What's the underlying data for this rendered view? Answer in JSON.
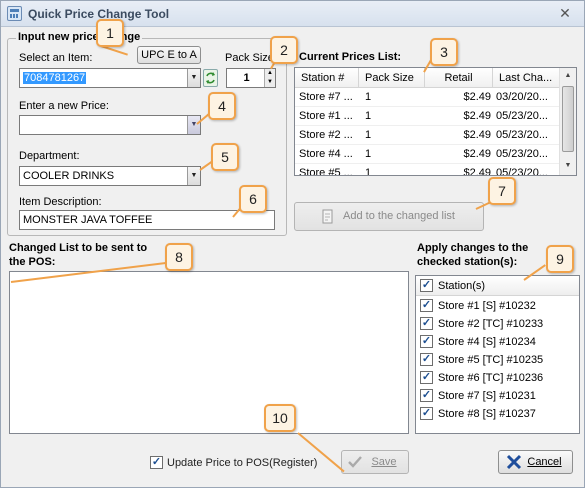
{
  "window": {
    "title": "Quick Price Change Tool",
    "close_glyph": "✕"
  },
  "input_group": {
    "legend": "Input new price change",
    "select_item_label": "Select an Item:",
    "upc_button": "UPC E to A",
    "item_value": "7084781267",
    "pack_size_label": "Pack Size",
    "pack_size_value": "1",
    "new_price_label": "Enter a new Price:",
    "new_price_value": "",
    "department_label": "Department:",
    "department_value": "COOLER DRINKS",
    "description_label": "Item Description:",
    "description_value": "MONSTER JAVA TOFFEE"
  },
  "current_prices": {
    "title": "Current Prices List:",
    "columns": [
      "Station #",
      "Pack Size",
      "Retail",
      "Last Cha..."
    ],
    "rows": [
      [
        "Store #7 ...",
        "1",
        "$2.49",
        "03/20/20..."
      ],
      [
        "Store #1 ...",
        "1",
        "$2.49",
        "05/23/20..."
      ],
      [
        "Store #2 ...",
        "1",
        "$2.49",
        "05/23/20..."
      ],
      [
        "Store #4 ...",
        "1",
        "$2.49",
        "05/23/20..."
      ],
      [
        "Store #5 ...",
        "1",
        "$2.49",
        "05/23/20..."
      ]
    ]
  },
  "add_button": "Add to the changed list",
  "changed_list": {
    "label_line1": "Changed List to be sent to",
    "label_line2": "the POS:"
  },
  "stations": {
    "label_line1": "Apply changes to the",
    "label_line2": "checked station(s):",
    "header": "Station(s)",
    "items": [
      "Store #1 [S] #10232",
      "Store #2 [TC] #10233",
      "Store #4 [S] #10234",
      "Store #5 [TC] #10235",
      "Store #6 [TC] #10236",
      "Store #7 [S] #10231",
      "Store #8 [S] #10237"
    ]
  },
  "footer": {
    "update_checkbox_label": "Update Price to POS(Register)",
    "save_button": "Save",
    "cancel_button": "Cancel"
  },
  "callouts": [
    "1",
    "2",
    "3",
    "4",
    "5",
    "6",
    "7",
    "8",
    "9",
    "10"
  ],
  "colors": {
    "callout_border": "#f0a24a",
    "callout_fill": "#fdf3e3",
    "selection": "#3399ff"
  }
}
